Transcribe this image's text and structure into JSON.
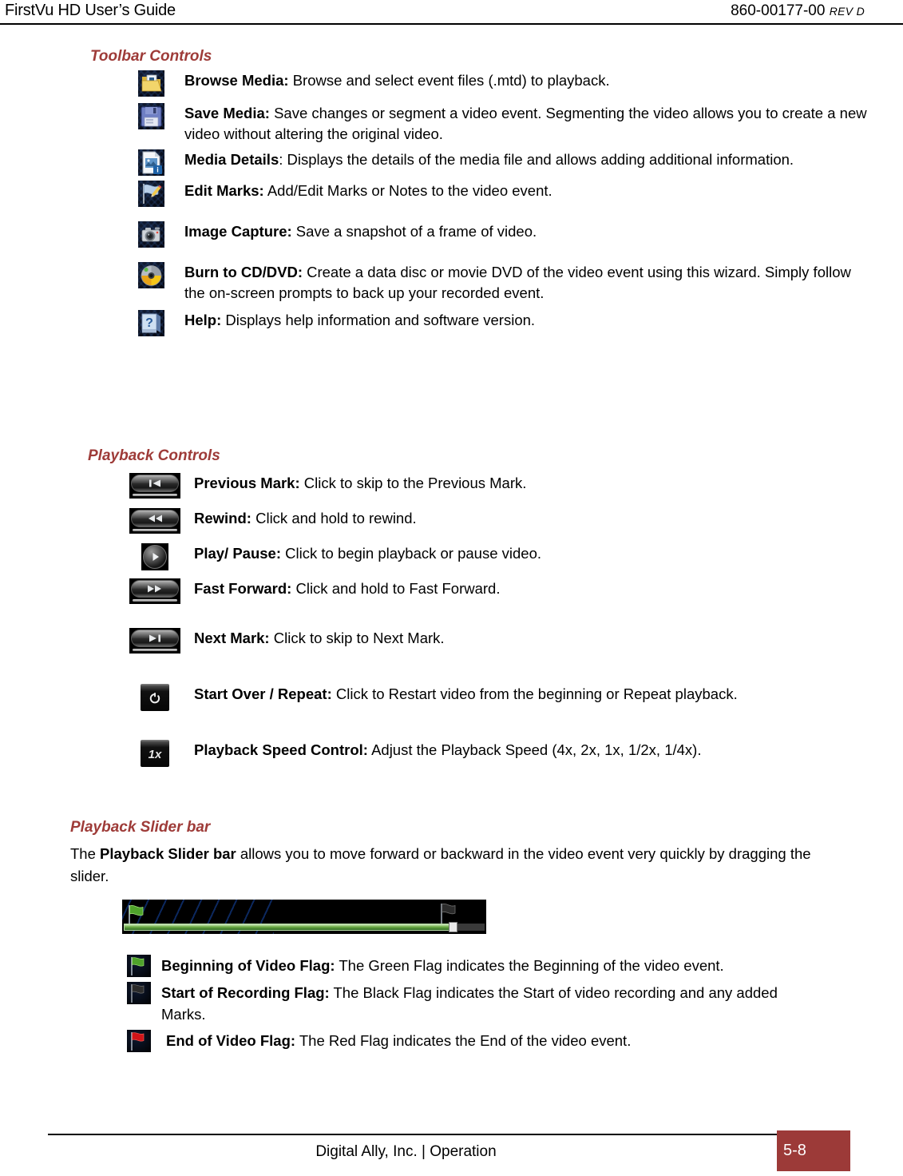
{
  "header": {
    "left_title": "FirstVu HD User’s Guide",
    "doc_number": "860-00177-00",
    "revision": "REV D"
  },
  "toolbar_section": {
    "heading": "Toolbar Controls",
    "items": [
      {
        "icon": "browse-media-folder-icon",
        "term": "Browse Media:",
        "description": " Browse and select event files (.mtd) to playback."
      },
      {
        "icon": "save-media-floppy-icon",
        "term": "Save Media:",
        "description": " Save changes or segment a video event. Segmenting the video allows you to create a new video without altering the original video."
      },
      {
        "icon": "media-details-document-icon",
        "term": "Media Details",
        "description": ": Displays the details of the media file and allows adding additional information."
      },
      {
        "icon": "edit-marks-flag-pencil-icon",
        "term": "Edit Marks:",
        "description": " Add/Edit Marks or Notes to the video event."
      },
      {
        "icon": "image-capture-camera-icon",
        "term": "Image Capture:",
        "description": " Save a snapshot of a frame of video."
      },
      {
        "icon": "burn-to-cd-dvd-disc-icon",
        "term": "Burn to CD/DVD:",
        "description": " Create a data disc or movie DVD of the video event using this wizard. Simply follow the on-screen prompts to back up your recorded event."
      },
      {
        "icon": "help-book-question-icon",
        "term": "Help:",
        "description": " Displays help information and software version."
      }
    ]
  },
  "playback_section": {
    "heading": "Playback Controls",
    "items": [
      {
        "icon": "previous-mark-button-icon",
        "term": "Previous Mark:",
        "description": " Click to skip to the Previous Mark."
      },
      {
        "icon": "rewind-button-icon",
        "term": "Rewind:",
        "description": " Click and hold to rewind."
      },
      {
        "icon": "play-pause-button-icon",
        "term": "Play/ Pause:",
        "description": " Click to begin playback or pause video."
      },
      {
        "icon": "fast-forward-button-icon",
        "term": "Fast Forward:",
        "description": " Click and hold to Fast Forward."
      },
      {
        "icon": "next-mark-button-icon",
        "term": "Next Mark:",
        "description": " Click to skip to Next Mark."
      },
      {
        "icon": "start-over-repeat-button-icon",
        "term": "Start Over / Repeat:",
        "description": " Click to Restart video from the beginning or Repeat playback."
      },
      {
        "icon": "playback-speed-control-button-icon",
        "term": "Playback Speed Control:",
        "description": " Adjust the Playback Speed (4x, 2x, 1x, 1/2x, 1/4x).",
        "glyph_label": "1x"
      }
    ]
  },
  "slider_section": {
    "heading": "Playback Slider bar",
    "paragraph_prefix": "The ",
    "paragraph_bold": "Playback Slider bar",
    "paragraph_suffix": " allows you to move forward or backward in the video event very quickly by dragging the slider.",
    "graphic_name": "playback-slider-bar-graphic"
  },
  "flag_section": {
    "items": [
      {
        "icon": "beginning-of-video-green-flag-icon",
        "term": "Beginning of Video Flag:",
        "description": " The Green Flag indicates the Beginning of the video event."
      },
      {
        "icon": "start-of-recording-black-flag-icon",
        "term": "Start of Recording Flag:",
        "description": " The Black Flag indicates the Start of video recording and any added Marks."
      },
      {
        "icon": "end-of-video-red-flag-icon",
        "term": "End of Video Flag:",
        "description": " The Red Flag indicates the End of the video event."
      }
    ]
  },
  "footer": {
    "center_text": "Digital Ally, Inc. | Operation",
    "page_number": "5-8"
  },
  "colors": {
    "heading": "#9E3B38",
    "footer_box": "#9C3A38",
    "flag_green": "#4FA32B",
    "flag_red": "#D01418",
    "flag_black": "#2B2B2B"
  }
}
